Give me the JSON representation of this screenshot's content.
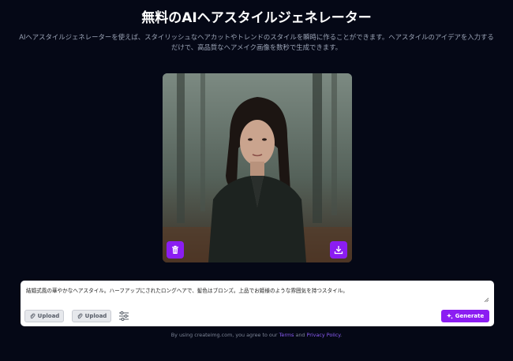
{
  "header": {
    "title": "無料のAIヘアスタイルジェネレーター",
    "subtitle": "AIヘアスタイルジェネレーターを使えば、スタイリッシュなヘアカットやトレンドのスタイルを瞬時に作ることができます。ヘアスタイルのアイデアを入力するだけで、高品質なヘアメイク画像を数秒で生成できます。"
  },
  "result": {
    "image_alt": "woman in forest portrait",
    "delete_icon": "trash-icon",
    "download_icon": "download-icon"
  },
  "prompt": {
    "value": "結婚式風の華やかなヘアスタイル。ハーフアップにされたロングヘアで、髪色はブロンズ。上品でお姫様のような雰囲気を持つスタイル。",
    "upload_label_1": "Upload",
    "upload_label_2": "Upload",
    "generate_label": "Generate",
    "accent_color": "#8b1df2"
  },
  "footer": {
    "prefix": "By using createimg.com, you agree to our",
    "terms": "Terms",
    "and": "and",
    "privacy": "Privacy Policy",
    "suffix": "."
  }
}
